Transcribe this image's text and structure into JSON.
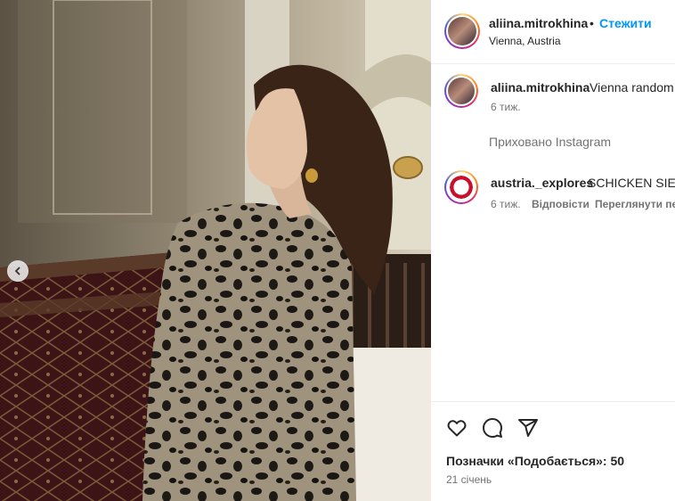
{
  "post": {
    "author": "aliina.mitrokhina",
    "follow_label": "Стежити",
    "separator": "•",
    "location": "Vienna, Austria"
  },
  "caption": {
    "author": "aliina.mitrokhina",
    "text": "Vienna random",
    "time": "6 тиж."
  },
  "hidden_notice": "Приховано Instagram",
  "comment": {
    "author": "austria._explores",
    "text": "SCHICKEN SIE E",
    "time": "6 тиж.",
    "reply_label": "Відповісти",
    "view_translation_label": "Переглянути пе"
  },
  "engagement": {
    "likes_text": "Позначки «Подобається»: 50",
    "date": "21 січень"
  },
  "icons": {
    "like": "heart-icon",
    "comment": "comment-icon",
    "share": "share-icon",
    "prev": "chevron-left-icon"
  }
}
